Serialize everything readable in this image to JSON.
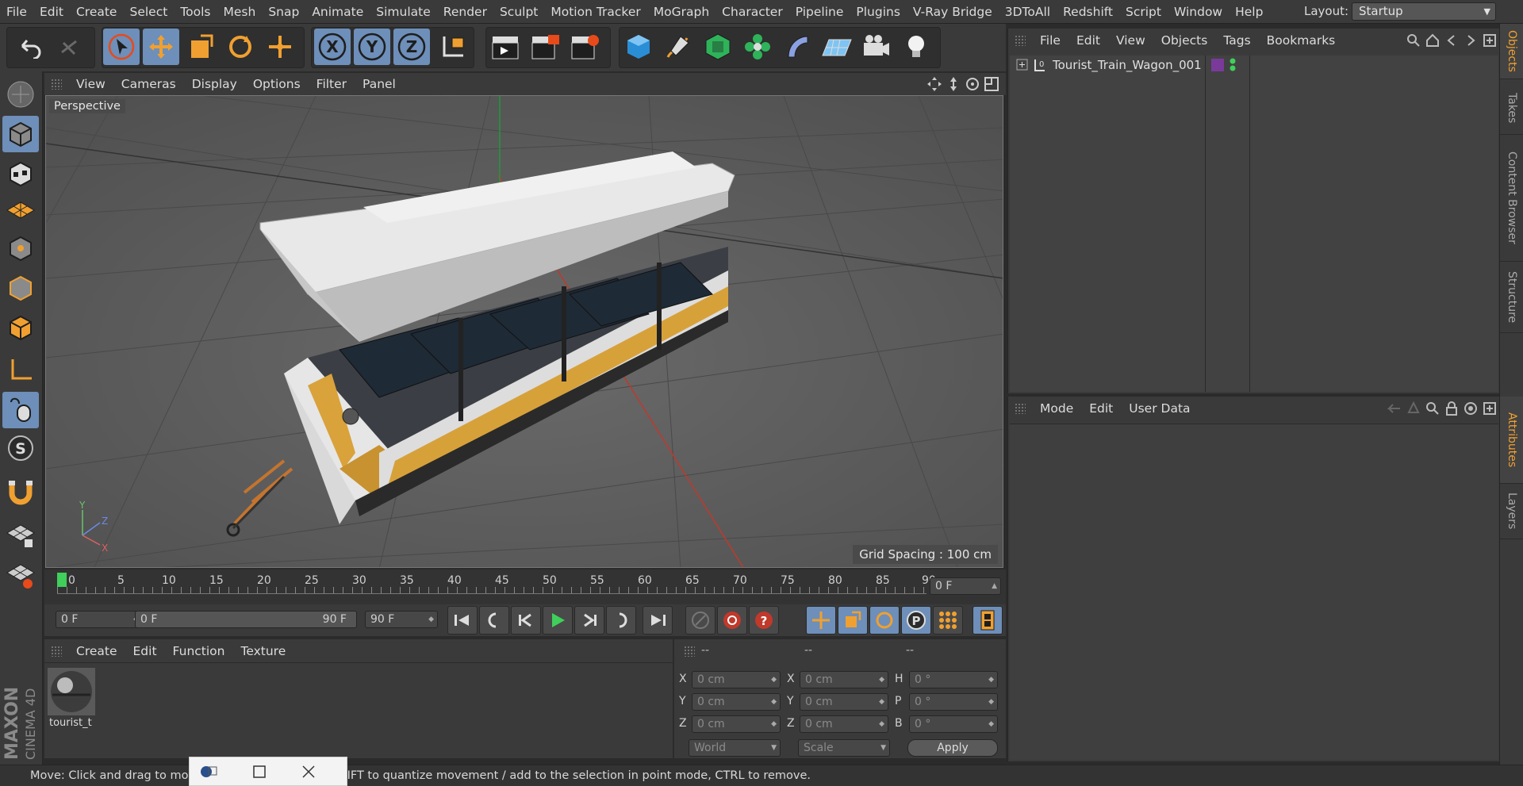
{
  "menubar": {
    "items": [
      "File",
      "Edit",
      "Create",
      "Select",
      "Tools",
      "Mesh",
      "Snap",
      "Animate",
      "Simulate",
      "Render",
      "Sculpt",
      "Motion Tracker",
      "MoGraph",
      "Character",
      "Pipeline",
      "Plugins",
      "V-Ray Bridge",
      "3DToAll",
      "Redshift",
      "Script",
      "Window",
      "Help"
    ],
    "layout_label": "Layout:",
    "layout_value": "Startup"
  },
  "viewport": {
    "menu": [
      "View",
      "Cameras",
      "Display",
      "Options",
      "Filter",
      "Panel"
    ],
    "camera_label": "Perspective",
    "grid_spacing": "Grid Spacing : 100 cm",
    "axis_labels": {
      "y": "Y",
      "z": "Z",
      "x": "X"
    }
  },
  "timeline": {
    "ticks": [
      "0",
      "5",
      "10",
      "15",
      "20",
      "25",
      "30",
      "35",
      "40",
      "45",
      "50",
      "55",
      "60",
      "65",
      "70",
      "75",
      "80",
      "85",
      "90"
    ],
    "current_frame": "0 F",
    "start_frame": "0 F",
    "range_start": "0 F",
    "range_end": "90 F",
    "end_frame": "90 F"
  },
  "material_manager": {
    "menu": [
      "Create",
      "Edit",
      "Function",
      "Texture"
    ],
    "material_name": "tourist_t"
  },
  "coordinates": {
    "headers": [
      "--",
      "--",
      "--"
    ],
    "rows": [
      {
        "pos_label": "X",
        "pos": "0 cm",
        "size_label": "X",
        "size": "0 cm",
        "rot_label": "H",
        "rot": "0 °"
      },
      {
        "pos_label": "Y",
        "pos": "0 cm",
        "size_label": "Y",
        "size": "0 cm",
        "rot_label": "P",
        "rot": "0 °"
      },
      {
        "pos_label": "Z",
        "pos": "0 cm",
        "size_label": "Z",
        "size": "0 cm",
        "rot_label": "B",
        "rot": "0 °"
      }
    ],
    "mode_select": "World",
    "scale_select": "Scale",
    "apply_label": "Apply"
  },
  "object_manager": {
    "menu": [
      "File",
      "Edit",
      "View",
      "Objects",
      "Tags",
      "Bookmarks"
    ],
    "objects": [
      {
        "name": "Tourist_Train_Wagon_001"
      }
    ]
  },
  "attribute_manager": {
    "menu": [
      "Mode",
      "Edit",
      "User Data"
    ]
  },
  "side_tabs": [
    "Objects",
    "Takes",
    "Content Browser",
    "Structure",
    "Attributes",
    "Layers"
  ],
  "status": {
    "text": "Move: Click and drag to move elements. Hold down SHIFT to quantize movement / add to the selection in point mode, CTRL to remove."
  },
  "logo": {
    "line1": "MAXON",
    "line2": "CINEMA 4D"
  },
  "colors": {
    "selected": "#6d8fb9",
    "accent": "#f0a030",
    "panel": "#3a3a3a"
  }
}
